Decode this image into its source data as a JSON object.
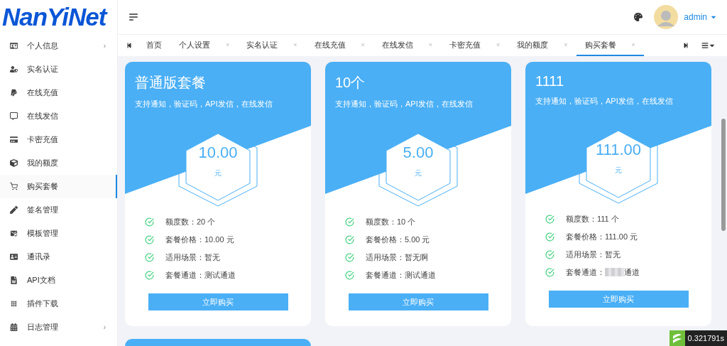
{
  "logo": "NanYiNet",
  "user": {
    "name": "admin"
  },
  "sidebar": {
    "items": [
      {
        "label": "个人信息",
        "arrow": "›",
        "selected": false
      },
      {
        "label": "实名认证",
        "selected": false
      },
      {
        "label": "在线充值",
        "selected": false
      },
      {
        "label": "在线发信",
        "selected": false
      },
      {
        "label": "卡密充值",
        "selected": false
      },
      {
        "label": "我的额度",
        "selected": false
      },
      {
        "label": "购买套餐",
        "selected": true
      },
      {
        "label": "签名管理",
        "selected": false
      },
      {
        "label": "模板管理",
        "selected": false
      },
      {
        "label": "通讯录",
        "selected": false
      },
      {
        "label": "API文档",
        "selected": false
      },
      {
        "label": "插件下载",
        "selected": false
      },
      {
        "label": "日志管理",
        "arrow": "›",
        "selected": false
      }
    ]
  },
  "tabs": [
    {
      "label": "首页",
      "selected": false
    },
    {
      "label": "个人设置",
      "close": "×",
      "selected": false
    },
    {
      "label": "实名认证",
      "close": "×",
      "selected": false
    },
    {
      "label": "在线充值",
      "close": "×",
      "selected": false
    },
    {
      "label": "在线发信",
      "close": "×",
      "selected": false
    },
    {
      "label": "卡密充值",
      "close": "×",
      "selected": false
    },
    {
      "label": "我的额度",
      "close": "×",
      "selected": false
    },
    {
      "label": "购买套餐",
      "close": "×",
      "selected": true
    }
  ],
  "packages": [
    {
      "partial": false,
      "title": "普通版套餐",
      "subtitle": "支持通知，验证码，API发信，在线发信",
      "price": "10.00",
      "unit": "元",
      "features": [
        {
          "label": "额度数：",
          "value": "20 个",
          "redacted": false
        },
        {
          "label": "套餐价格：",
          "value": "10.00 元",
          "redacted": false
        },
        {
          "label": "适用场景：",
          "value": "暂无",
          "redacted": false
        },
        {
          "label": "套餐通道：",
          "value": "测试通道",
          "redacted": false
        }
      ],
      "button": "立即购买"
    },
    {
      "partial": false,
      "title": "10个",
      "subtitle": "支持通知，验证码，API发信，在线发信",
      "price": "5.00",
      "unit": "元",
      "features": [
        {
          "label": "额度数：",
          "value": "10 个",
          "redacted": false
        },
        {
          "label": "套餐价格：",
          "value": "5.00 元",
          "redacted": false
        },
        {
          "label": "适用场景：",
          "value": "暂无啊",
          "redacted": false
        },
        {
          "label": "套餐通道：",
          "value": "测试通道",
          "redacted": false
        }
      ],
      "button": "立即购买"
    },
    {
      "partial": false,
      "title": "1111",
      "subtitle": "支持通知，验证码，API发信，在线发信",
      "price": "111.00",
      "unit": "元",
      "features": [
        {
          "label": "额度数：",
          "value": "111 个",
          "redacted": false
        },
        {
          "label": "套餐价格：",
          "value": "111.00 元",
          "redacted": false
        },
        {
          "label": "适用场景：",
          "value": "暂无",
          "redacted": false
        },
        {
          "label": "套餐通道：",
          "value": "通道",
          "redacted": true
        }
      ],
      "button": "立即购买"
    },
    {
      "partial": true
    }
  ],
  "debug_timer": "0.321791s"
}
